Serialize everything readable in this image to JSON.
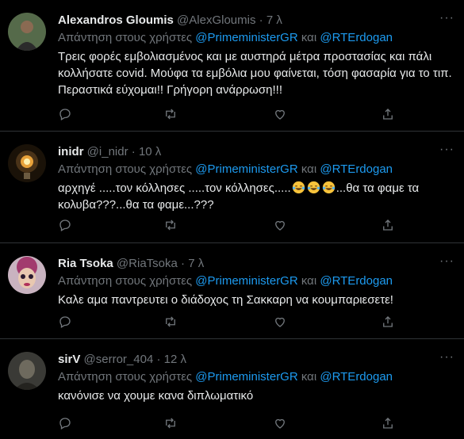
{
  "tweets": [
    {
      "name": "Alexandros Gloumis",
      "handle": "@AlexGloumis",
      "time": "7 λ",
      "reply_prefix": "Απάντηση στους χρήστες",
      "mention1": "@PrimeministerGR",
      "reply_and": "και",
      "mention2": "@RTErdogan",
      "text": "Τρεις φορές εμβολιασμένος και με αυστηρά μέτρα προστασίας και πάλι κολλήσατε covid. Μούφα τα εμβόλια μου φαίνεται, τόση φασαρία για το τιπ. Περαστικά εύχομαι!! Γρήγορη ανάρρωση!!!"
    },
    {
      "name": "inidr",
      "handle": "@i_nidr",
      "time": "10 λ",
      "reply_prefix": "Απάντηση στους χρήστες",
      "mention1": "@PrimeministerGR",
      "reply_and": "και",
      "mention2": "@RTErdogan",
      "text_a": "αρχηγέ .....τον κόλλησες .....τον κόλλησες.....",
      "text_b": "...θα τα φαμε τα κολυβα???...θα τα φαμε...???",
      "emoji": "face-with-tears-of-joy"
    },
    {
      "name": "Ria Tsoka",
      "handle": "@RiaTsoka",
      "time": "7 λ",
      "reply_prefix": "Απάντηση στους χρήστες",
      "mention1": "@PrimeministerGR",
      "reply_and": "και",
      "mention2": "@RTErdogan",
      "text": "Καλε αμα παντρευτει ο διάδοχος τη Σακκαρη να κουμπαριεσετε!"
    },
    {
      "name": "sirV",
      "handle": "@serror_404",
      "time": "12 λ",
      "reply_prefix": "Απάντηση στους χρήστες",
      "mention1": "@PrimeministerGR",
      "reply_and": "και",
      "mention2": "@RTErdogan",
      "text": "κανόνισε να χουμε κανα διπλωματικό"
    }
  ],
  "separator": "·",
  "icons": [
    "reply-icon",
    "retweet-icon",
    "like-icon",
    "share-icon",
    "more-icon"
  ],
  "colors": {
    "background": "#000000",
    "text": "#e7e9ea",
    "muted": "#71767b",
    "link": "#1d9bf0",
    "divider": "#2f3336"
  }
}
